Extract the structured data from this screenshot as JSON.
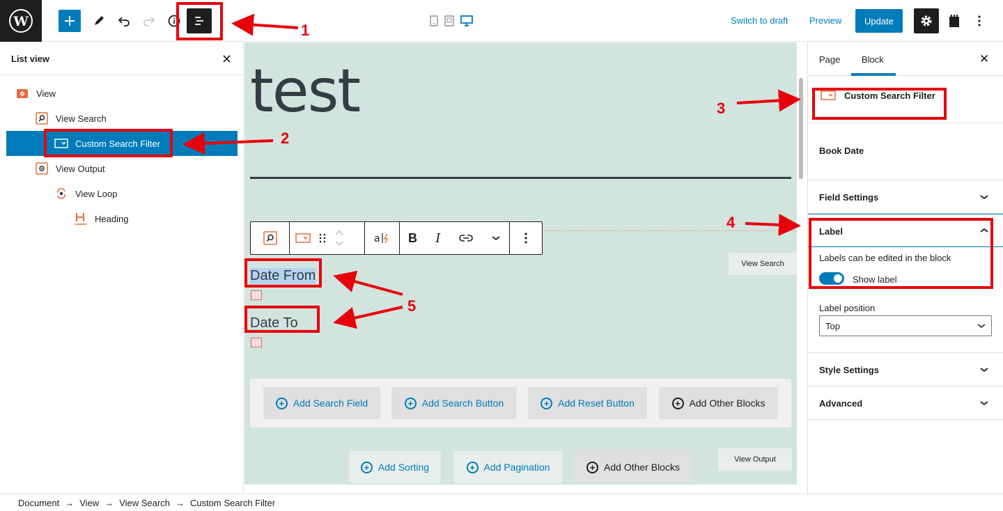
{
  "topbar": {
    "switch_to_draft": "Switch to draft",
    "preview": "Preview",
    "update": "Update"
  },
  "list_view": {
    "title": "List view",
    "items": [
      {
        "label": "View"
      },
      {
        "label": "View Search"
      },
      {
        "label": "Custom Search Filter"
      },
      {
        "label": "View Output"
      },
      {
        "label": "View Loop"
      },
      {
        "label": "Heading"
      }
    ]
  },
  "canvas": {
    "title": "test",
    "date_from": "Date From",
    "date_to": "Date To",
    "view_search_badge": "View Search",
    "view_output_badge": "View Output",
    "add_row_1": [
      "Add Search Field",
      "Add Search Button",
      "Add Reset Button",
      "Add Other Blocks"
    ],
    "add_row_2": [
      "Add Sorting",
      "Add Pagination",
      "Add Other Blocks"
    ]
  },
  "inspector": {
    "tab_page": "Page",
    "tab_block": "Block",
    "block_name": "Custom Search Filter",
    "field_name": "Book Date",
    "field_settings": "Field Settings",
    "label_panel": "Label",
    "label_help": "Labels can be edited in the block",
    "show_label": "Show label",
    "label_position_label": "Label position",
    "label_position_value": "Top",
    "style_settings": "Style Settings",
    "advanced": "Advanced"
  },
  "breadcrumb": [
    "Document",
    "View",
    "View Search",
    "Custom Search Filter"
  ],
  "annotations": [
    "1",
    "2",
    "3",
    "4",
    "5"
  ],
  "colors": {
    "accent": "#007cba",
    "annotation_red": "#e8000b",
    "canvas_bg": "#d2e4de",
    "block_icon_orange": "#e26f3c"
  }
}
